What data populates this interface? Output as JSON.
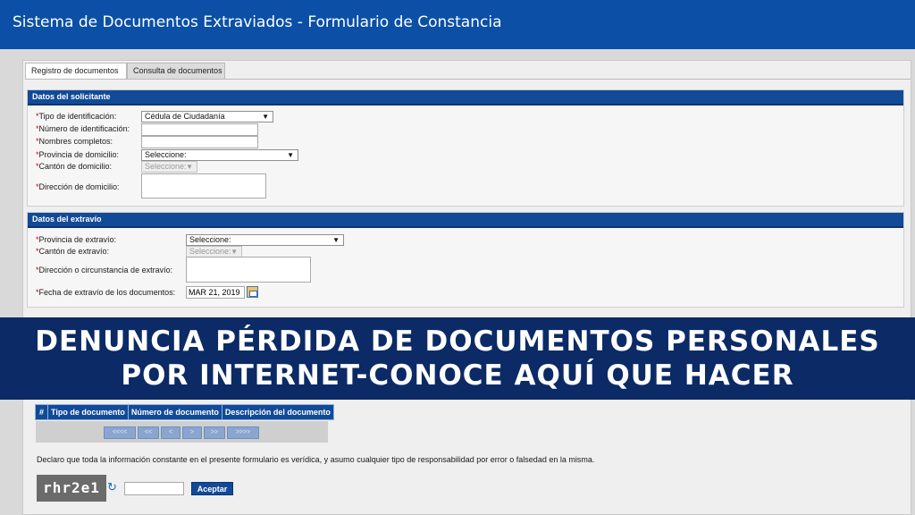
{
  "header": {
    "title": "Sistema de Documentos Extraviados - Formulario de Constancia"
  },
  "tabs": [
    {
      "label": "Registro de documentos",
      "active": true
    },
    {
      "label": "Consulta de documentos",
      "active": false
    }
  ],
  "solicitante": {
    "heading": "Datos del solicitante",
    "required_mark": "*",
    "tipo_identificacion": {
      "label": "Tipo de identificación:",
      "value": "Cédula de Ciudadanía"
    },
    "numero_identificacion": {
      "label": "Número de identificación:",
      "value": ""
    },
    "nombres": {
      "label": "Nombres completos:",
      "value": ""
    },
    "provincia": {
      "label": "Provincia de domicilio:",
      "value": "Seleccione:"
    },
    "canton": {
      "label": "Cantón de domicilio:",
      "value": "Seleccione:"
    },
    "direccion": {
      "label": "Dirección de domicilio:",
      "value": ""
    }
  },
  "extravio": {
    "heading": "Datos del extravío",
    "provincia": {
      "label": "Provincia de extravío:",
      "value": "Seleccione:"
    },
    "canton": {
      "label": "Cantón de extravío:",
      "value": "Seleccione:"
    },
    "direccion": {
      "label": "Dirección o circunstancia de extravío:",
      "value": ""
    },
    "fecha": {
      "label": "Fecha de extravío de los documentos:",
      "value": "MAR 21, 2019"
    }
  },
  "banner": {
    "line1": "DENUNCIA PÉRDIDA DE DOCUMENTOS PERSONALES",
    "line2": "POR INTERNET-CONOCE AQUÍ QUE HACER"
  },
  "documents_table": {
    "columns": [
      "#",
      "Tipo de documento",
      "Número de documento",
      "Descripción del documento"
    ],
    "pager": [
      "<<<<",
      "<<",
      "<",
      ">",
      ">>",
      ">>>>"
    ]
  },
  "declaration": "Declaro que toda la información constante en el presente formulario es verídica, y asumo cualquier tipo de responsabilidad por error o falsedad en la misma.",
  "captcha": {
    "text": "rhr2e1",
    "input_value": ""
  },
  "accept_label": "Aceptar",
  "colors": {
    "header_bg": "#0b50a6",
    "section_head": "#124a98",
    "banner_bg": "#0b2a66",
    "required": "#cc0000"
  },
  "icons": {
    "select_arrow": "▼",
    "refresh": "↻",
    "calendar": "calendar-icon"
  }
}
